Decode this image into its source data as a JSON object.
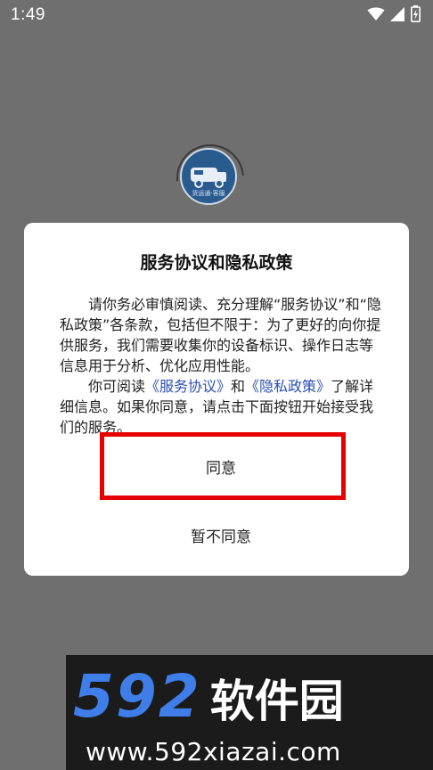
{
  "status_bar": {
    "time": "1:49"
  },
  "app_logo": {
    "text": "货运通·客服"
  },
  "dialog": {
    "title": "服务协议和隐私政策",
    "paragraph1": "请你务必审慎阅读、充分理解“服务协议”和“隐私政策”各条款，包括但不限于：为了更好的向你提供服务，我们需要收集你的设备标识、操作日志等信息用于分析、优化应用性能。",
    "paragraph2_prefix": "你可阅读",
    "link_service": "《服务协议》",
    "paragraph2_and": "和",
    "link_privacy": "《隐私政策》",
    "paragraph2_suffix": "了解详细信息。如果你同意，请点击下面按钮开始接受我们的服务。",
    "agree_label": "同意",
    "decline_label": "暂不同意"
  },
  "watermark": {
    "number": "592",
    "brand": "软件园",
    "url": "www.592xiazai.com"
  },
  "colors": {
    "scrim": "#6f6f6f",
    "link": "#2b4fb3",
    "highlight": "#e60000",
    "watermark_blue": "#3f7ee8"
  }
}
